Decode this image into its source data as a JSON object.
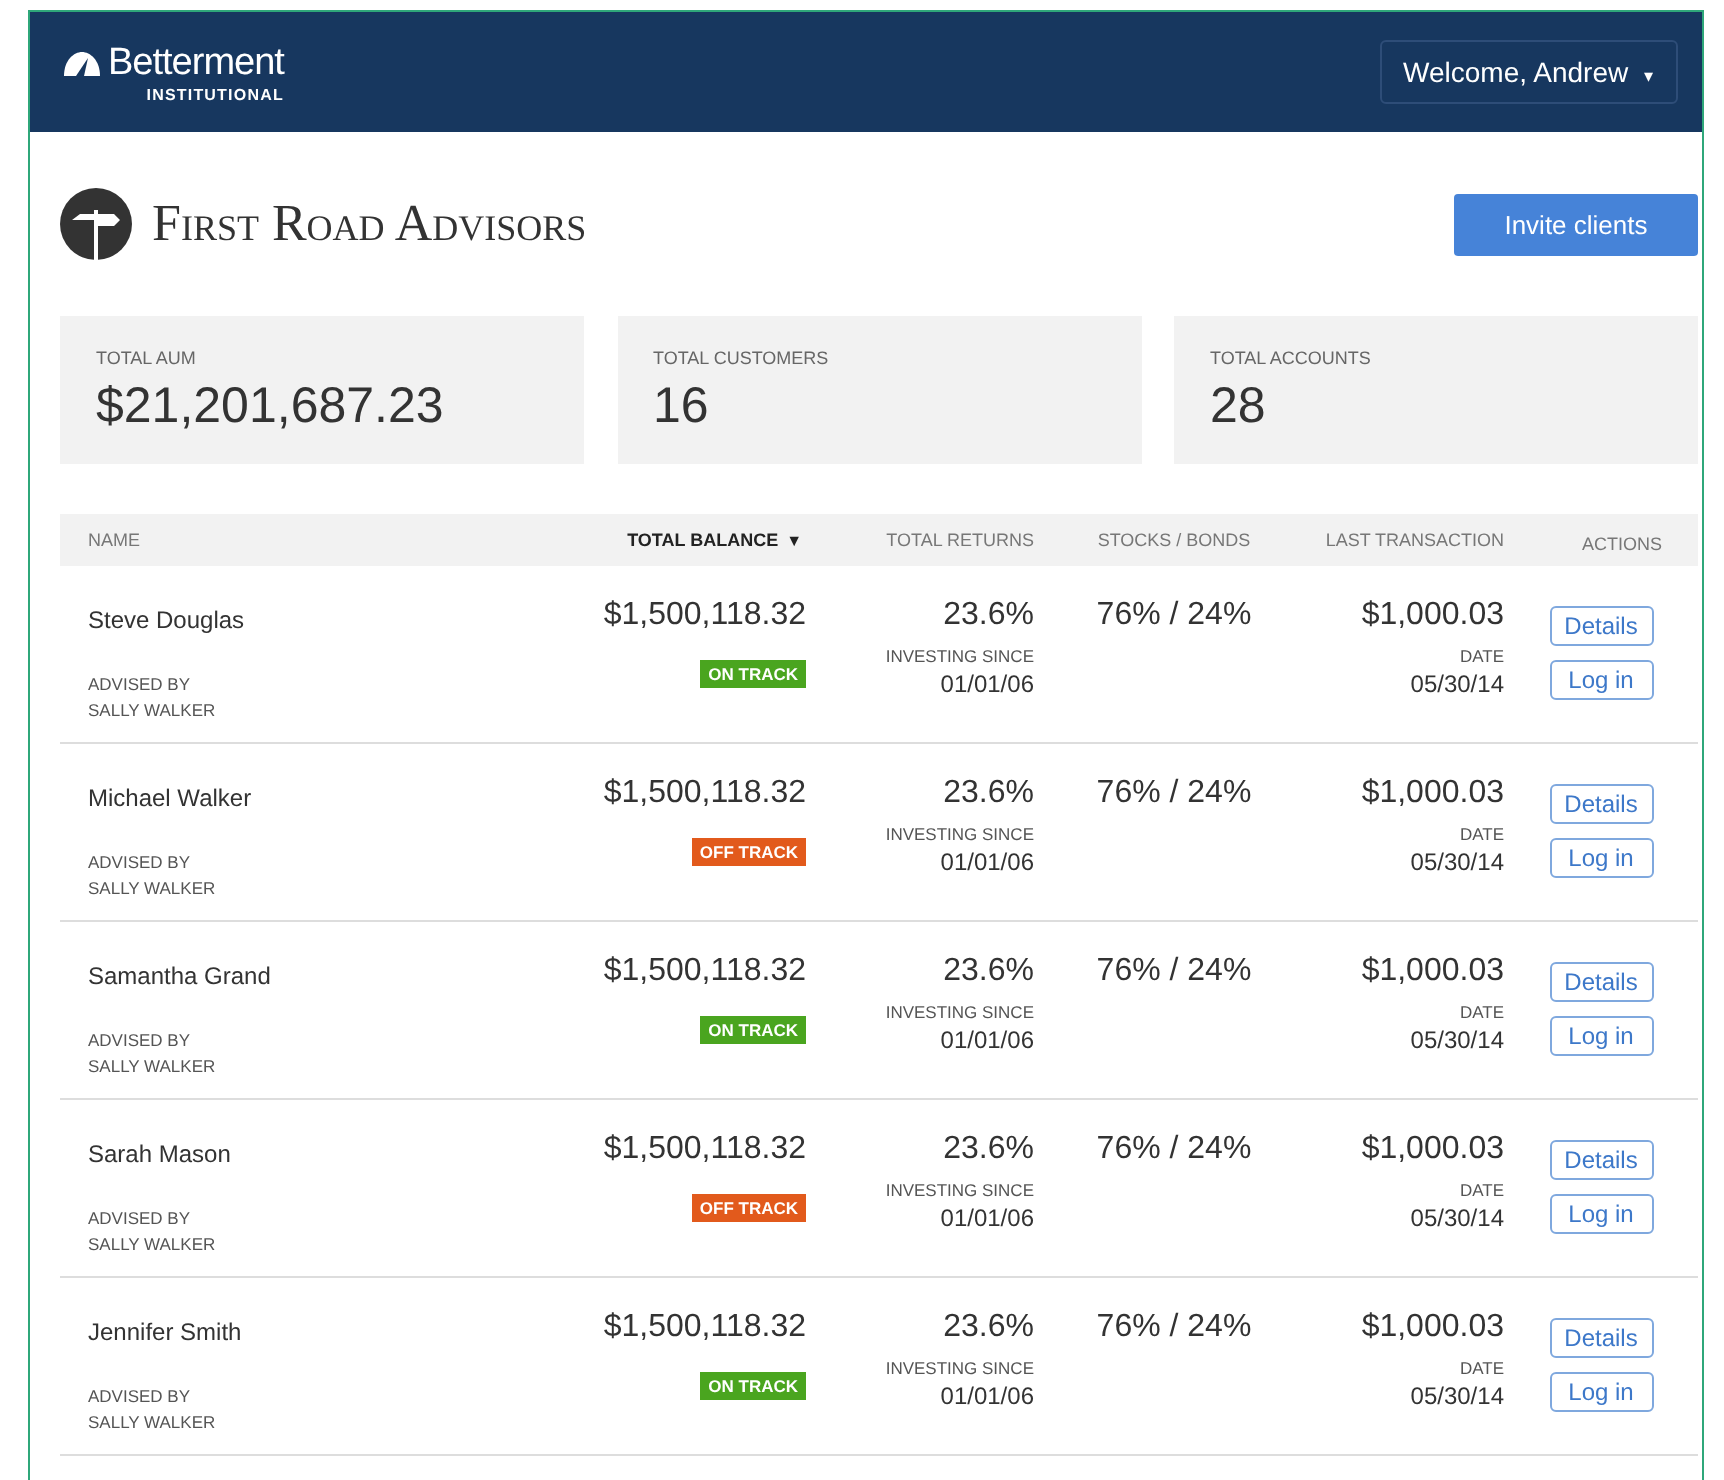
{
  "header": {
    "brand": "Betterment",
    "brand_sub": "INSTITUTIONAL",
    "user_menu": "Welcome, Andrew",
    "user_menu_caret": "▾"
  },
  "firm": {
    "name": "First Road Advisors",
    "action": "Invite clients"
  },
  "stats": [
    {
      "label": "TOTAL AUM",
      "value": "$21,201,687.23"
    },
    {
      "label": "TOTAL CUSTOMERS",
      "value": "16"
    },
    {
      "label": "TOTAL ACCOUNTS",
      "value": "28"
    }
  ],
  "table": {
    "columns": [
      {
        "label": "NAME",
        "selected": false
      },
      {
        "label": "TOTAL BALANCE",
        "selected": true,
        "sort": "▼"
      },
      {
        "label": "TOTAL RETURNS",
        "selected": false
      },
      {
        "label": "STOCKS / BONDS",
        "selected": false
      },
      {
        "label": "LAST TRANSACTION",
        "selected": false
      },
      {
        "label": "ACTIONS",
        "selected": false
      }
    ],
    "rows": [
      {
        "name": "Steve Douglas",
        "advised_label": "ADVISED BY",
        "advisor": "SALLY WALKER",
        "balance": "$1,500,118.32",
        "status": {
          "kind": "on",
          "label": "ON TRACK"
        },
        "returns": "23.6%",
        "since_label": "INVESTING SINCE",
        "since": "01/01/06",
        "allocation": "76% / 24%",
        "last_amount": "$1,000.03",
        "date_label": "DATE",
        "date": "05/30/14",
        "actions": [
          "Details",
          "Log in"
        ]
      },
      {
        "name": "Michael Walker",
        "advised_label": "ADVISED BY",
        "advisor": "SALLY WALKER",
        "balance": "$1,500,118.32",
        "status": {
          "kind": "off",
          "label": "OFF TRACK"
        },
        "returns": "23.6%",
        "since_label": "INVESTING SINCE",
        "since": "01/01/06",
        "allocation": "76% / 24%",
        "last_amount": "$1,000.03",
        "date_label": "DATE",
        "date": "05/30/14",
        "actions": [
          "Details",
          "Log in"
        ]
      },
      {
        "name": "Samantha Grand",
        "advised_label": "ADVISED BY",
        "advisor": "SALLY WALKER",
        "balance": "$1,500,118.32",
        "status": {
          "kind": "on",
          "label": "ON TRACK"
        },
        "returns": "23.6%",
        "since_label": "INVESTING SINCE",
        "since": "01/01/06",
        "allocation": "76% / 24%",
        "last_amount": "$1,000.03",
        "date_label": "DATE",
        "date": "05/30/14",
        "actions": [
          "Details",
          "Log in"
        ]
      },
      {
        "name": "Sarah Mason",
        "advised_label": "ADVISED BY",
        "advisor": "SALLY WALKER",
        "balance": "$1,500,118.32",
        "status": {
          "kind": "off",
          "label": "OFF TRACK"
        },
        "returns": "23.6%",
        "since_label": "INVESTING SINCE",
        "since": "01/01/06",
        "allocation": "76% / 24%",
        "last_amount": "$1,000.03",
        "date_label": "DATE",
        "date": "05/30/14",
        "actions": [
          "Details",
          "Log in"
        ]
      },
      {
        "name": "Jennifer Smith",
        "advised_label": "ADVISED BY",
        "advisor": "SALLY WALKER",
        "balance": "$1,500,118.32",
        "status": {
          "kind": "on",
          "label": "ON TRACK"
        },
        "returns": "23.6%",
        "since_label": "INVESTING SINCE",
        "since": "01/01/06",
        "allocation": "76% / 24%",
        "last_amount": "$1,000.03",
        "date_label": "DATE",
        "date": "05/30/14",
        "actions": [
          "Details",
          "Log in"
        ]
      }
    ]
  }
}
